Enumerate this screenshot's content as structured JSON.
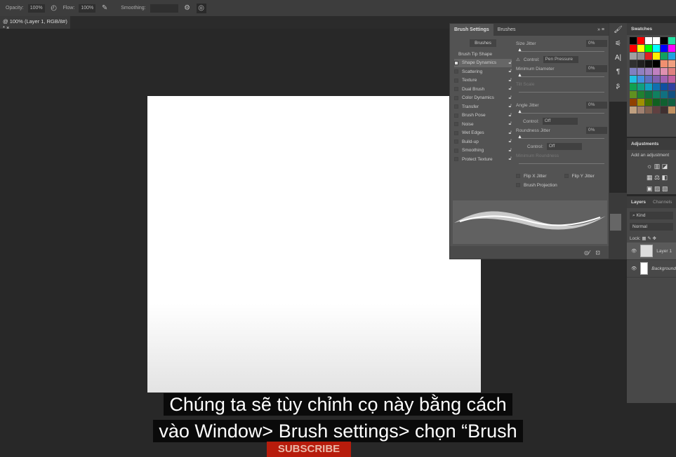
{
  "options_bar": {
    "opacity_label": "Opacity:",
    "opacity_value": "100%",
    "flow_label": "Flow:",
    "flow_value": "100%",
    "smoothing_label": "Smoothing:"
  },
  "document_tab": {
    "title": "@ 100% (Layer 1, RGB/8#) *",
    "close": "×"
  },
  "brush_settings": {
    "tabs": [
      "Brush Settings",
      "Brushes"
    ],
    "brushes_button": "Brushes",
    "tip_shape": "Brush Tip Shape",
    "options": [
      {
        "label": "Shape Dynamics",
        "checked": true
      },
      {
        "label": "Scattering",
        "checked": false
      },
      {
        "label": "Texture",
        "checked": false
      },
      {
        "label": "Dual Brush",
        "checked": false
      },
      {
        "label": "Color Dynamics",
        "checked": false
      },
      {
        "label": "Transfer",
        "checked": false
      },
      {
        "label": "Brush Pose",
        "checked": false
      },
      {
        "label": "Noise",
        "checked": false
      },
      {
        "label": "Wet Edges",
        "checked": false
      },
      {
        "label": "Build-up",
        "checked": false
      },
      {
        "label": "Smoothing",
        "checked": false
      },
      {
        "label": "Protect Texture",
        "checked": false
      }
    ],
    "size_jitter": {
      "label": "Size Jitter",
      "value": "0%"
    },
    "control_label": "Control:",
    "control1": "Pen Pressure",
    "min_diameter": {
      "label": "Minimum Diameter",
      "value": "0%"
    },
    "tilt_scale": "Tilt Scale",
    "angle_jitter": {
      "label": "Angle Jitter",
      "value": "0%"
    },
    "control2": "Off",
    "roundness_jitter": {
      "label": "Roundness Jitter",
      "value": "0%"
    },
    "control3": "Off",
    "min_roundness": "Minimum Roundness",
    "flip_x": "Flip X Jitter",
    "flip_y": "Flip Y Jitter",
    "projection": "Brush Projection"
  },
  "swatches": {
    "title": "Swatches",
    "colors": [
      "#000000",
      "#ff0000",
      "#ffffff",
      "#ffffff",
      "#000000",
      "#20e0a0",
      "#00ff00",
      "#ff0000",
      "#ffff00",
      "#00ff00",
      "#00ffff",
      "#0000ff",
      "#ff00ff",
      "#ff8080",
      "#a0a0a0",
      "#909090",
      "#e02020",
      "#ffee00",
      "#10a060",
      "#20a0e0",
      "#e0a060",
      "#303030",
      "#202020",
      "#101010",
      "#000000",
      "#f09070",
      "#f0a080",
      "#f0b090",
      "#8080c0",
      "#9080c0",
      "#a080c0",
      "#c080c0",
      "#e090b0",
      "#e08080",
      "#e0a0a0",
      "#20c0e0",
      "#4090e0",
      "#6070c0",
      "#8060b0",
      "#a060b0",
      "#c060a0",
      "#6040a0",
      "#10a050",
      "#10a080",
      "#10a0c0",
      "#1070b0",
      "#1050a0",
      "#3040a0",
      "#5030a0",
      "#609020",
      "#208030",
      "#107040",
      "#108060",
      "#107080",
      "#105080",
      "#103060",
      "#904000",
      "#a09000",
      "#407000",
      "#106020",
      "#106030",
      "#106040",
      "#105050",
      "#c0a080",
      "#a08070",
      "#806050",
      "#604040",
      "#403030",
      "#c09060",
      "#906040"
    ]
  },
  "adjustments": {
    "title": "Adjustments",
    "subtitle": "Add an adjustment"
  },
  "layers_panel": {
    "tabs": [
      "Layers",
      "Channels"
    ],
    "filter": "Kind",
    "blend": "Normal",
    "lock": "Lock:",
    "layers": [
      "Layer 1",
      "Background"
    ]
  },
  "subtitles": [
    "Chúng ta sẽ tùy chỉnh cọ này bằng cách",
    "vào Window> Brush settings> chọn “Brush"
  ],
  "subscribe": "SUBSCRIBE"
}
